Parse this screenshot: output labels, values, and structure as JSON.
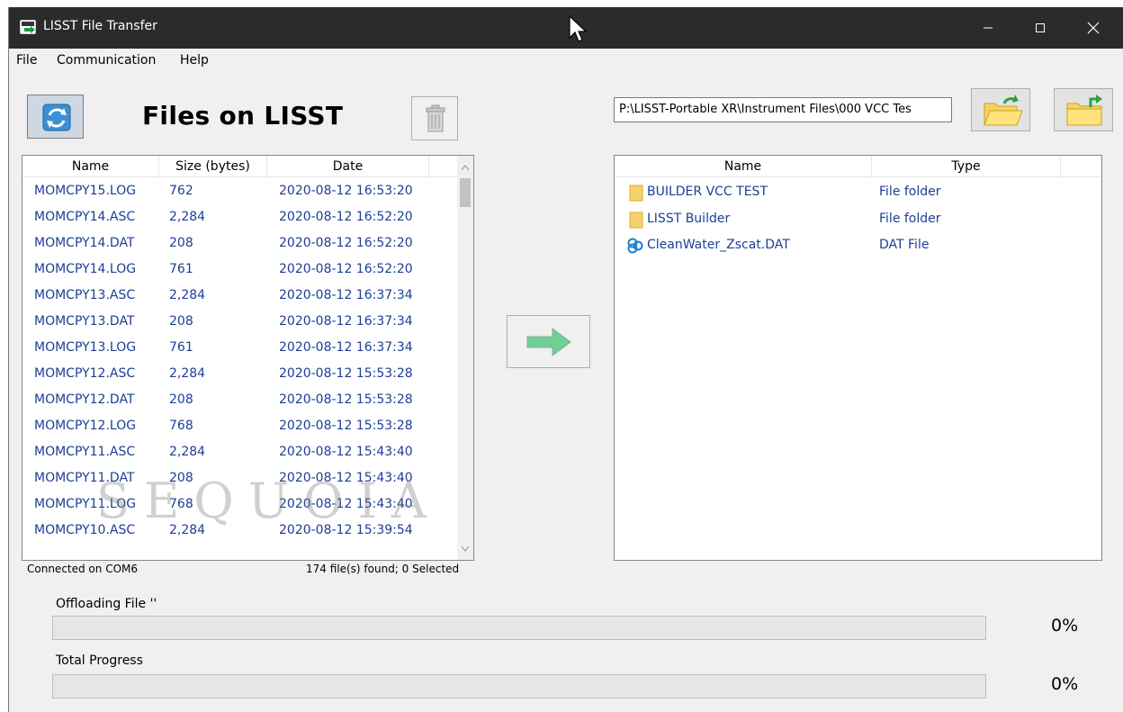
{
  "window": {
    "title": "LISST File Transfer"
  },
  "menu": [
    "File",
    "Communication",
    "Help"
  ],
  "left_panel": {
    "title": "Files on LISST",
    "columns": [
      "Name",
      "Size (bytes)",
      "Date"
    ],
    "rows": [
      {
        "name": "MOMCPY15.LOG",
        "size": "762",
        "date": "2020-08-12 16:53:20"
      },
      {
        "name": "MOMCPY14.ASC",
        "size": "2,284",
        "date": "2020-08-12 16:52:20"
      },
      {
        "name": "MOMCPY14.DAT",
        "size": "208",
        "date": "2020-08-12 16:52:20"
      },
      {
        "name": "MOMCPY14.LOG",
        "size": "761",
        "date": "2020-08-12 16:52:20"
      },
      {
        "name": "MOMCPY13.ASC",
        "size": "2,284",
        "date": "2020-08-12 16:37:34"
      },
      {
        "name": "MOMCPY13.DAT",
        "size": "208",
        "date": "2020-08-12 16:37:34"
      },
      {
        "name": "MOMCPY13.LOG",
        "size": "761",
        "date": "2020-08-12 16:37:34"
      },
      {
        "name": "MOMCPY12.ASC",
        "size": "2,284",
        "date": "2020-08-12 15:53:28"
      },
      {
        "name": "MOMCPY12.DAT",
        "size": "208",
        "date": "2020-08-12 15:53:28"
      },
      {
        "name": "MOMCPY12.LOG",
        "size": "768",
        "date": "2020-08-12 15:53:28"
      },
      {
        "name": "MOMCPY11.ASC",
        "size": "2,284",
        "date": "2020-08-12 15:43:40"
      },
      {
        "name": "MOMCPY11.DAT",
        "size": "208",
        "date": "2020-08-12 15:43:40"
      },
      {
        "name": "MOMCPY11.LOG",
        "size": "768",
        "date": "2020-08-12 15:43:40"
      },
      {
        "name": "MOMCPY10.ASC",
        "size": "2,284",
        "date": "2020-08-12 15:39:54"
      }
    ],
    "watermark": "SEQUOIA",
    "status_connection": "Connected on COM6",
    "status_count": "174 file(s) found; 0 Selected"
  },
  "right_panel": {
    "path": "P:\\LISST-Portable XR\\Instrument Files\\000 VCC Tes",
    "columns": [
      "Name",
      "Type"
    ],
    "rows": [
      {
        "name": "BUILDER VCC TEST",
        "type": "File folder",
        "icon": "folder-icon"
      },
      {
        "name": "LISST Builder",
        "type": "File folder",
        "icon": "folder-icon"
      },
      {
        "name": "CleanWater_Zscat.DAT",
        "type": "DAT File",
        "icon": "dat-file-icon"
      }
    ]
  },
  "progress": {
    "offloading_label": "Offloading File ''",
    "offloading_pct": "0%",
    "offloading_value": 0,
    "total_label": "Total Progress",
    "total_pct": "0%",
    "total_value": 0
  },
  "colors": {
    "titlebar": "#2b2b2b",
    "list_text": "#1c3f95",
    "arrow": "#6fcf97"
  }
}
